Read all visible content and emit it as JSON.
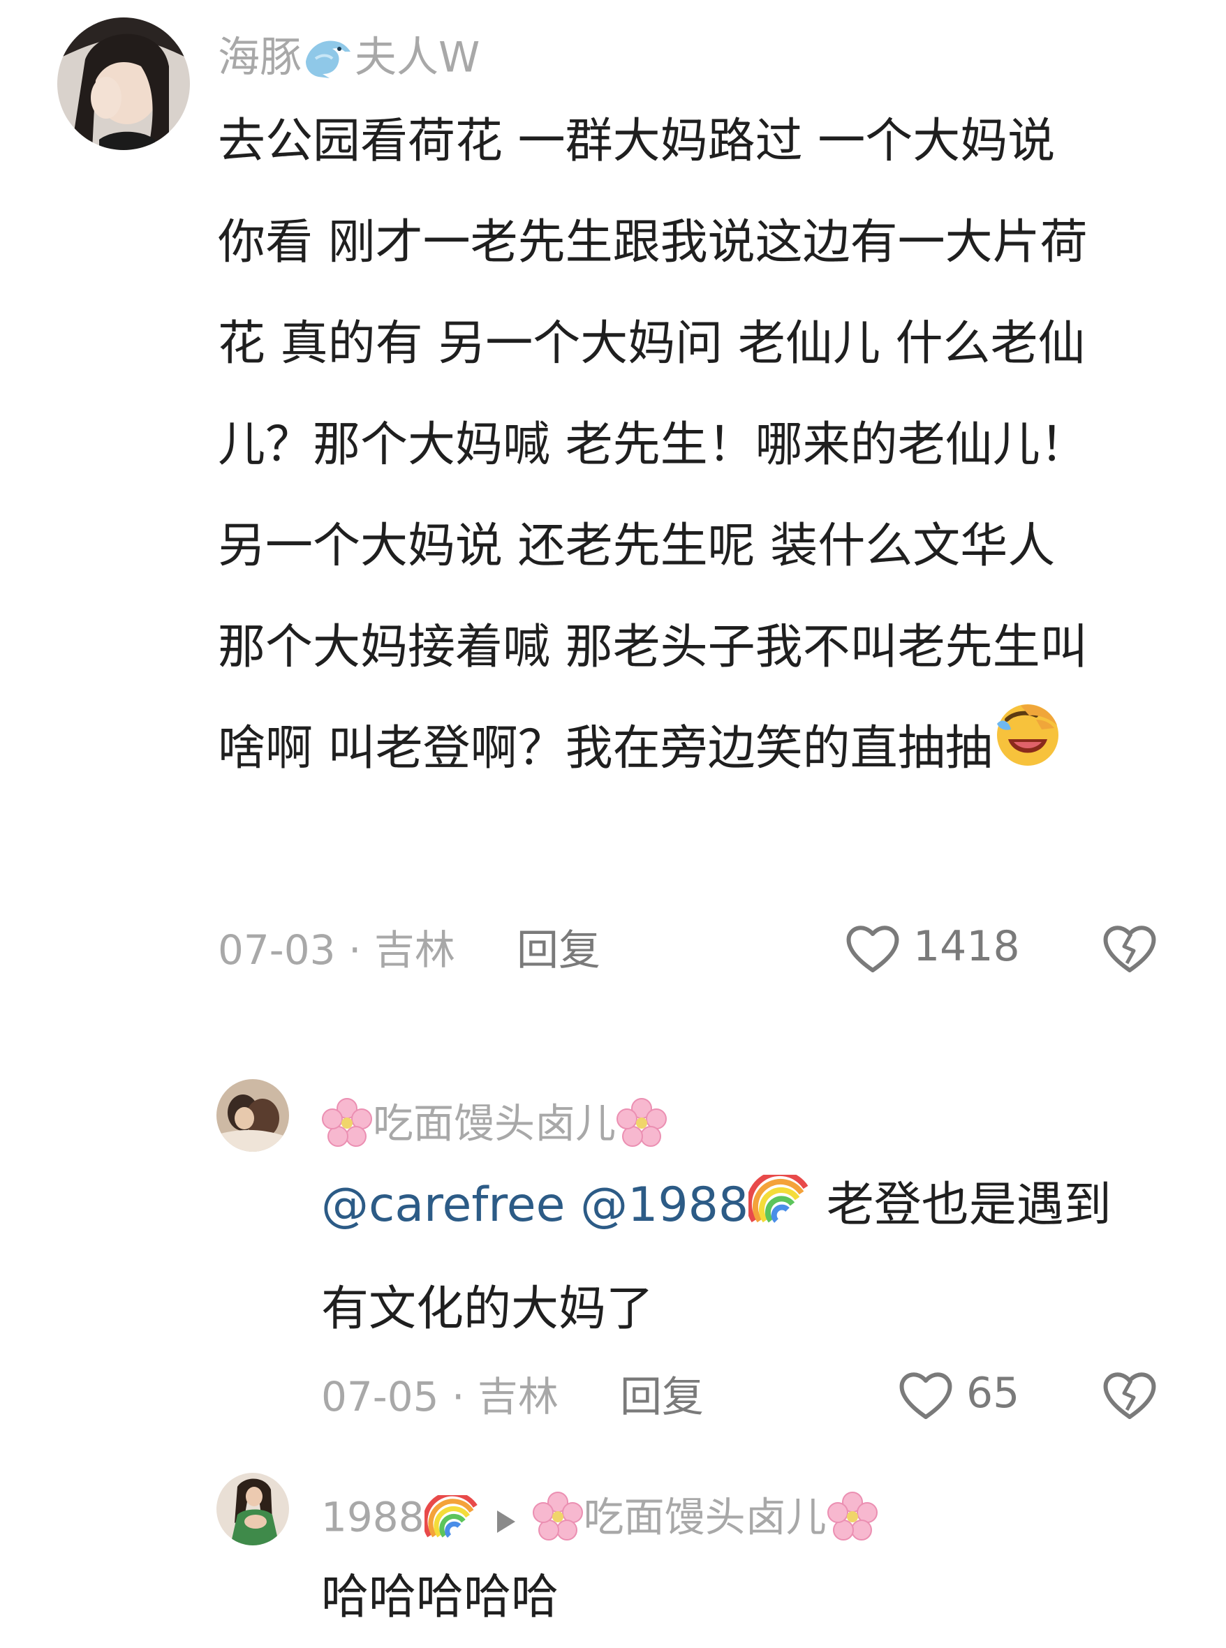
{
  "comments": [
    {
      "username_prefix": "海豚",
      "username_suffix": "夫人W",
      "username_icon": "dolphin-icon",
      "lines": [
        "去公园看荷花 一群大妈路过 一个大妈说",
        "你看 刚才一老先生跟我说这边有一大片荷",
        "花 真的有 另一个大妈问 老仙儿 什么老仙",
        "儿？那个大妈喊 老先生！哪来的老仙儿！",
        "另一个大妈说 还老先生呢 装什么文华人",
        "那个大妈接着喊 那老头子我不叫老先生叫",
        "啥啊 叫老登啊？我在旁边笑的直抽抽"
      ],
      "trailing_icon": "rofl-emoji",
      "meta": "07-03 · 吉林",
      "reply_label": "回复",
      "like_count": "1418"
    }
  ],
  "replies": [
    {
      "username": "吃面馒头卤儿",
      "username_icons": [
        "cherry-blossom-icon",
        "cherry-blossom-icon"
      ],
      "mention_1": "@carefree",
      "mention_2": "@1988",
      "mention_icon": "rainbow-icon",
      "line_1_rest": " 老登也是遇到",
      "line_2": "有文化的大妈了",
      "meta": "07-05 · 吉林",
      "reply_label": "回复",
      "like_count": "65"
    },
    {
      "from_user": "1988",
      "from_icon": "rainbow-icon",
      "arrow_icon": "play-triangle-icon",
      "to_user": "吃面馒头卤儿",
      "to_icons": [
        "cherry-blossom-icon",
        "cherry-blossom-icon"
      ],
      "text": "哈哈哈哈哈"
    }
  ],
  "colors": {
    "username": "#a8a8a8",
    "text": "#1f1f1f",
    "mention": "#2c5b86",
    "meta": "#a8a8a8",
    "action": "#7a7a7a"
  }
}
